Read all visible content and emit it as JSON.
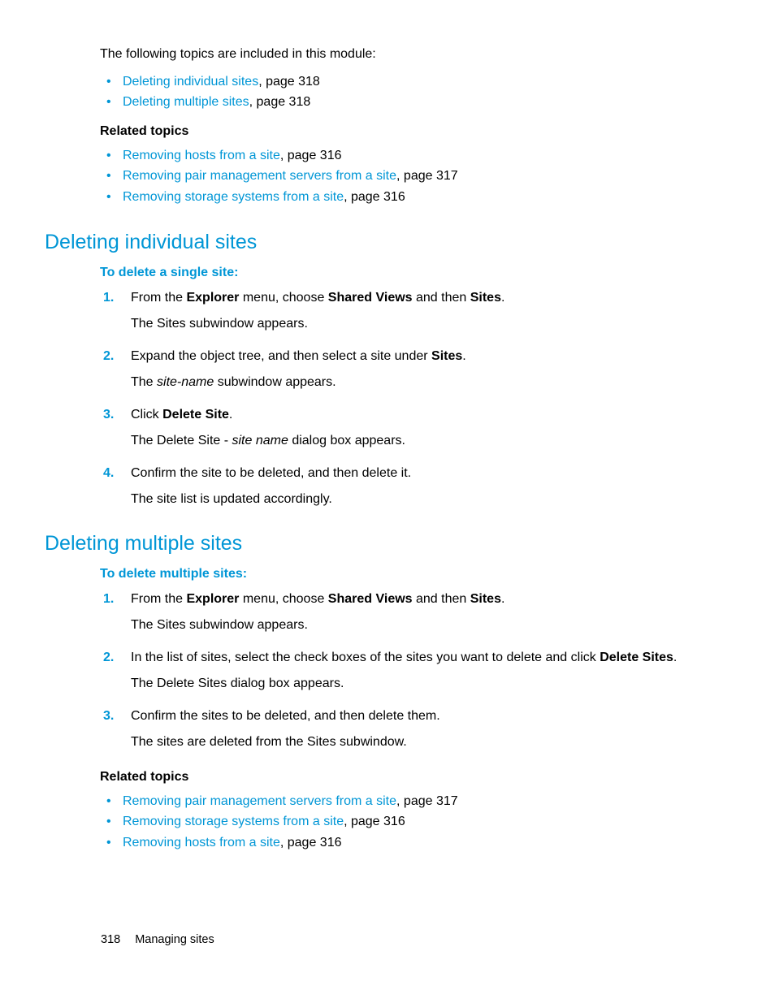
{
  "intro": {
    "lead": "The following topics are included in this module:",
    "topics": [
      {
        "link": "Deleting individual sites",
        "suffix": ", page 318"
      },
      {
        "link": "Deleting multiple sites",
        "suffix": ", page 318"
      }
    ],
    "related_heading": "Related topics",
    "related": [
      {
        "link": "Removing hosts from a site",
        "suffix": ", page 316"
      },
      {
        "link": "Removing pair management servers from a site",
        "suffix": ", page 317"
      },
      {
        "link": "Removing storage systems from a site",
        "suffix": ", page 316"
      }
    ]
  },
  "section1": {
    "title": "Deleting individual sites",
    "procedure_heading": "To delete a single site:",
    "steps": [
      {
        "main_pre": "From the ",
        "main_b1": "Explorer",
        "main_mid": " menu, choose ",
        "main_b2": "Shared Views",
        "main_mid2": " and then ",
        "main_b3": "Sites",
        "main_post": ".",
        "note": "The Sites subwindow appears."
      },
      {
        "main_pre": "Expand the object tree, and then select a site under ",
        "main_b1": "Sites",
        "main_post": ".",
        "note_pre": "The ",
        "note_i": "site-name",
        "note_post": " subwindow appears."
      },
      {
        "main_pre": "Click ",
        "main_b1": "Delete Site",
        "main_post": ".",
        "note_pre": "The Delete Site - ",
        "note_i": "site name",
        "note_post": " dialog box appears."
      },
      {
        "main_pre": "Confirm the site to be deleted, and then delete it.",
        "note": "The site list is updated accordingly."
      }
    ]
  },
  "section2": {
    "title": "Deleting multiple sites",
    "procedure_heading": "To delete multiple sites:",
    "steps": [
      {
        "main_pre": "From the ",
        "main_b1": "Explorer",
        "main_mid": " menu, choose ",
        "main_b2": "Shared Views",
        "main_mid2": " and then ",
        "main_b3": "Sites",
        "main_post": ".",
        "note": "The Sites subwindow appears."
      },
      {
        "main_pre": "In the list of sites, select the check boxes of the sites you want to delete and click ",
        "main_b1": "Delete Sites",
        "main_post": ".",
        "note": "The Delete Sites dialog box appears."
      },
      {
        "main_pre": "Confirm the sites to be deleted, and then delete them.",
        "note": "The sites are deleted from the Sites subwindow."
      }
    ],
    "related_heading": "Related topics",
    "related": [
      {
        "link": "Removing pair management servers from a site",
        "suffix": ", page 317"
      },
      {
        "link": "Removing storage systems from a site",
        "suffix": ", page 316"
      },
      {
        "link": "Removing hosts from a site",
        "suffix": ", page 316"
      }
    ]
  },
  "footer": {
    "page_number": "318",
    "section": "Managing sites"
  }
}
